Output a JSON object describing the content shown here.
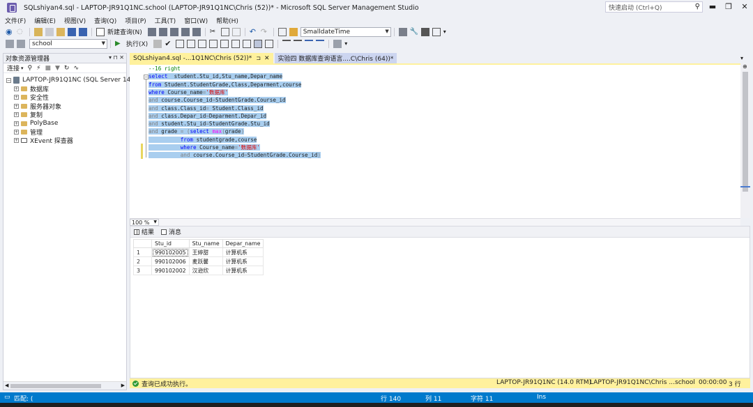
{
  "window": {
    "title": "SQLshiyan4.sql - LAPTOP-JR91Q1NC.school (LAPTOP-JR91Q1NC\\Chris (52))* - Microsoft SQL Server Management Studio",
    "quick_launch_placeholder": "快速启动 (Ctrl+Q)"
  },
  "menu": [
    "文件(F)",
    "编辑(E)",
    "视图(V)",
    "查询(Q)",
    "项目(P)",
    "工具(T)",
    "窗口(W)",
    "帮助(H)"
  ],
  "toolbar1": {
    "new_query_label": "新建查询(N)",
    "type_combo_value": "SmalldateTime"
  },
  "toolbar2": {
    "database_combo_value": "school",
    "execute_label": "执行(X)"
  },
  "object_explorer": {
    "title": "对象资源管理器",
    "connect_label": "连接",
    "server": "LAPTOP-JR91Q1NC (SQL Server 14.0.",
    "nodes": [
      "数据库",
      "安全性",
      "服务器对象",
      "复制",
      "PolyBase",
      "管理",
      "XEvent 探查器"
    ]
  },
  "tabs": {
    "active": "SQLshiyan4.sql -...1Q1NC\\Chris (52))*",
    "inactive": "实验四 数据库查询语言....C\\Chris (64))*"
  },
  "editor": {
    "comment_line": "--16 right",
    "zoom": "100 %"
  },
  "results": {
    "tab_results": "结果",
    "tab_messages": "消息",
    "columns": [
      "Stu_id",
      "Stu_name",
      "Depar_name"
    ],
    "rows": [
      {
        "num": "1",
        "Stu_id": "990102005",
        "Stu_name": "王婷甜",
        "Depar_name": "计算机系"
      },
      {
        "num": "2",
        "Stu_id": "990102006",
        "Stu_name": "麦跃馨",
        "Depar_name": "计算机系"
      },
      {
        "num": "3",
        "Stu_id": "990102002",
        "Stu_name": "汉逊欣",
        "Depar_name": "计算机系"
      }
    ]
  },
  "query_status": {
    "message": "查询已成功执行。",
    "server": "LAPTOP-JR91Q1NC (14.0 RTM)",
    "user": "LAPTOP-JR91Q1NC\\Chris ...",
    "database": "school",
    "elapsed": "00:00:00",
    "rows": "3 行"
  },
  "app_status": {
    "state": "匹配: (",
    "line": "行 140",
    "col": "列 11",
    "ch": "字符 11",
    "mode": "Ins"
  },
  "colors": {
    "accent_status": "#007acc",
    "tab_active": "#fff19d",
    "selection": "#a9ceef",
    "keyword": "#0000ff",
    "string": "#e00000"
  }
}
